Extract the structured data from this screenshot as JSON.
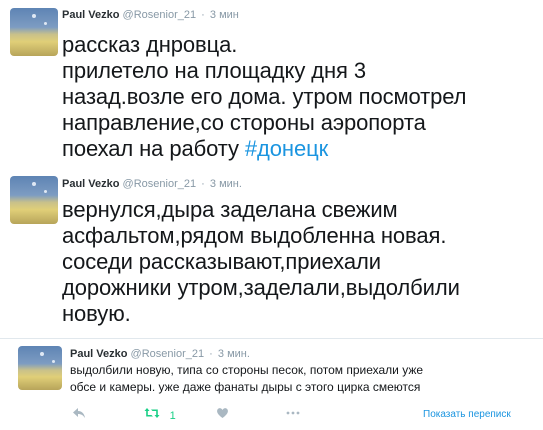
{
  "tweets": [
    {
      "author_name": "Paul Vezko",
      "handle": "@Rosenior_21",
      "dot": "·",
      "time": "3 мин",
      "text_lines": "рассказ днровца.\nприлетело на площадку дня 3\nназад.возле его дома. утром посмотрел\nнаправление,со стороны аэропорта\nпоехал на работу ",
      "hashtag": "#донецк"
    },
    {
      "author_name": "Paul Vezko",
      "handle": "@Rosenior_21",
      "dot": "·",
      "time": "3 мин.",
      "text_lines": "вернулся,дыра заделана свежим\nасфальтом,рядом выдобленна новая.\nсоседи рассказывают,приехали\nдорожники утром,заделали,выдолбили\nновую."
    }
  ],
  "card": {
    "author_name": "Paul Vezko",
    "handle": "@Rosenior_21",
    "dot": "·",
    "time": "3 мин.",
    "text_lines": "выдолбили новую, типа со стороны песок, потом приехали уже\nобсе и камеры.  уже даже фанаты дыры с этого цирка смеются",
    "retweet_count": "1",
    "translate_label": "Показать переписк",
    "icons": {
      "reply": "reply-icon",
      "retweet": "retweet-icon",
      "like": "heart-icon",
      "more": "more-icon"
    }
  }
}
